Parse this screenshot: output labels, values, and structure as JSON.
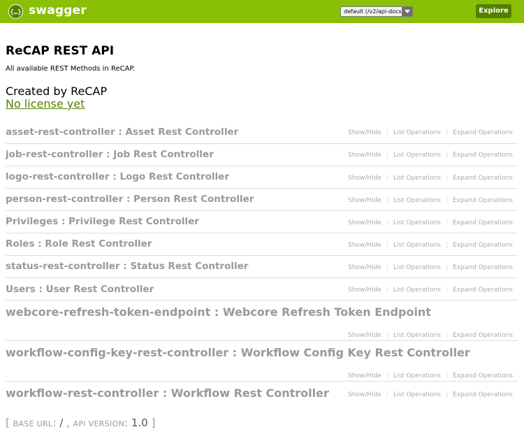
{
  "header": {
    "logo_text": "swagger",
    "select_value": "default (/v2/api-docs)",
    "explore_label": "Explore",
    "color": "#89bf04"
  },
  "info": {
    "title": "ReCAP REST API",
    "description": "All available REST Methods in ReCAP.",
    "created_by": "Created by ReCAP",
    "license": "No license yet"
  },
  "operations_labels": {
    "show_hide": "Show/Hide",
    "list": "List Operations",
    "expand": "Expand Operations"
  },
  "resources": [
    {
      "name": "asset-rest-controller : Asset Rest Controller"
    },
    {
      "name": "job-rest-controller : Job Rest Controller"
    },
    {
      "name": "logo-rest-controller : Logo Rest Controller"
    },
    {
      "name": "person-rest-controller : Person Rest Controller"
    },
    {
      "name": "Privileges : Privilege Rest Controller"
    },
    {
      "name": "Roles : Role Rest Controller"
    },
    {
      "name": "status-rest-controller : Status Rest Controller"
    },
    {
      "name": "Users : User Rest Controller"
    },
    {
      "name": "webcore-refresh-token-endpoint : Webcore Refresh Token Endpoint"
    },
    {
      "name": "workflow-config-key-rest-controller : Workflow Config Key Rest Controller"
    },
    {
      "name": "workflow-rest-controller : Workflow Rest Controller"
    }
  ],
  "footer": {
    "open": "[",
    "base_url_label": "BASE URL",
    "base_url": "/",
    "api_version_label": "API VERSION",
    "api_version": "1.0",
    "close": "]"
  }
}
